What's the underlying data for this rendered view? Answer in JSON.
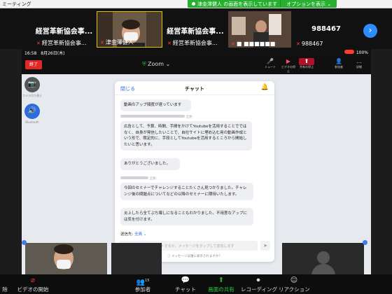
{
  "window": {
    "title": "ミーティング"
  },
  "share_banner": {
    "text": "津金澤健人 の画面を表示しています",
    "options_label": "オプションを表示 ⌄"
  },
  "strip": {
    "tiles": [
      {
        "big_name": "経営革新協会事...",
        "caption": "経営革新協会事..."
      },
      {
        "big_name": "",
        "caption": "津金澤健人"
      },
      {
        "big_name": "経営革新協会事...",
        "caption": "経営革新協会事..."
      },
      {
        "big_name": "",
        "caption": "■ ■■■■■■"
      },
      {
        "big_name": "988467",
        "caption": "988467"
      }
    ],
    "next_icon": "›"
  },
  "phone": {
    "status": {
      "time": "16:58　8月26日(木)",
      "right": "100%"
    },
    "end_label": "終了",
    "zoom_title": "Zoom ⌄",
    "tools": [
      {
        "label": "ミュート",
        "icon": "🎤"
      },
      {
        "label": "ビデオの停止",
        "icon": "▶"
      },
      {
        "label": "共有の停止",
        "icon": "⬆"
      },
      {
        "label": "参加者",
        "icon": "👤"
      },
      {
        "label": "詳細",
        "icon": "…"
      }
    ],
    "left_camera_label": "カメラ切り替え",
    "left_blue_label": "Bluetooth"
  },
  "chat": {
    "close_label": "閉じる",
    "title": "チャット",
    "bell_icon": "🔔",
    "messages": [
      {
        "text": "動画のアップ頻度が速っています"
      },
      {
        "meta": "全員：",
        "text": "広告として、予算、時間、手間をかけてYoutubeを活用することでではなく、自身が発信したいことで、自社サイトに埋め込む用の動画作成という形で、限定的に、手段としてYoutubeを活用するところから開始したいと思います。"
      },
      {
        "text": "ありがとうございました。"
      },
      {
        "meta": "全員：",
        "text": "今回のセミナーでチャレンジすることたくさん見つかりました。チャレンジ後の問題点についてなどの以降のセミナーに期待いたします。"
      },
      {
        "text": "炎上したら全てぶち壊しになることもわかりました。不用意なアップには気を付けます。"
      }
    ],
    "send_to_label": "送信先:",
    "send_to_value": "全員 ⌄",
    "input_placeholder": "ここをタップしてチャットするか、メッセージをタップして返信します",
    "note": "メッセージは誰に表示されますか？"
  },
  "toolbar": {
    "items": [
      {
        "label": "除",
        "icon": ""
      },
      {
        "label": "ビデオの開始",
        "icon": "📷"
      },
      {
        "label": "参加者",
        "icon": "👥",
        "badge": "15"
      },
      {
        "label": "チャット",
        "icon": "💬"
      },
      {
        "label": "画面の共有",
        "icon": "⬆"
      },
      {
        "label": "レコーディング",
        "icon": "⏺"
      },
      {
        "label": "リアクション",
        "icon": "☺"
      }
    ]
  },
  "colors": {
    "accent": "#2d8cff",
    "share_green": "#27b030",
    "end_red": "#e02828"
  }
}
